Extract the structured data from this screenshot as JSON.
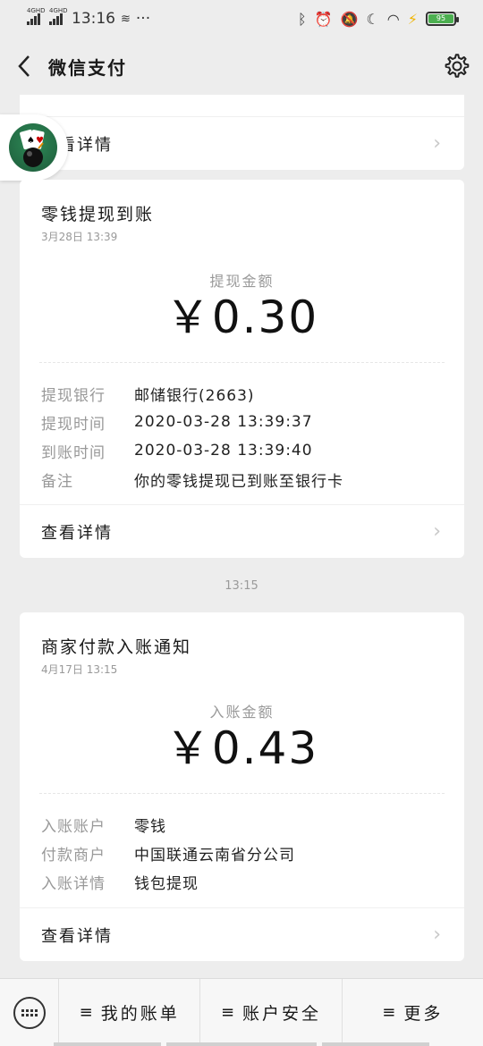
{
  "status_bar": {
    "signal1": "4GHD",
    "signal2": "4GHD",
    "time": "13:16",
    "dots": "···",
    "battery": "95"
  },
  "nav": {
    "back_icon": "chevron-left-icon",
    "title": "微信支付",
    "settings_icon": "gear-icon"
  },
  "top_card": {
    "more_label": "查看详情"
  },
  "card1": {
    "name": "零钱提现到账",
    "time": "3月28日 13:39",
    "amount_label": "提现金额",
    "amount": "￥0.30",
    "rows": [
      {
        "k": "提现银行",
        "v": "邮储银行(2663)"
      },
      {
        "k": "提现时间",
        "v": "2020-03-28 13:39:37"
      },
      {
        "k": "到账时间",
        "v": "2020-03-28 13:39:40"
      },
      {
        "k": "备注",
        "v": "你的零钱提现已到账至银行卡"
      }
    ],
    "more_label": "查看详情"
  },
  "timestamp": "13:15",
  "card2": {
    "name": "商家付款入账通知",
    "time": "4月17日 13:15",
    "amount_label": "入账金额",
    "amount": "￥0.43",
    "rows": [
      {
        "k": "入账账户",
        "v": "零钱"
      },
      {
        "k": "付款商户",
        "v": "中国联通云南省分公司"
      },
      {
        "k": "入账详情",
        "v": "钱包提现"
      }
    ],
    "more_label": "查看详情"
  },
  "bottom_menu": {
    "items": [
      "我的账单",
      "账户安全",
      "更多"
    ]
  },
  "colors": {
    "background": "#ededed",
    "card": "#ffffff",
    "muted": "#999999",
    "battery": "#4caf50"
  }
}
